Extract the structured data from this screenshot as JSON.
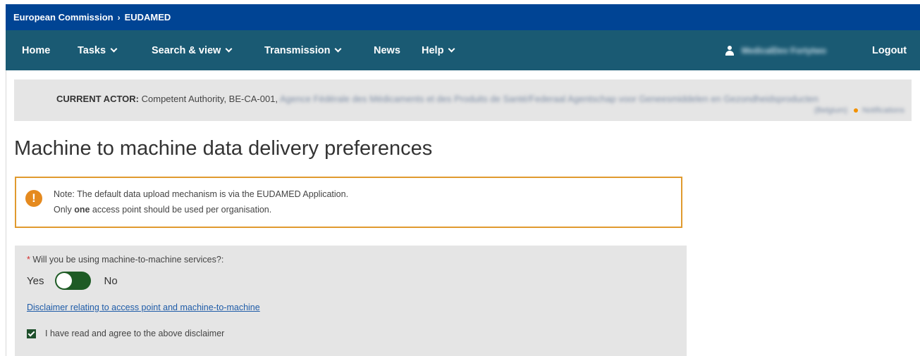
{
  "breadcrumb": {
    "item1": "European Commission",
    "separator": "›",
    "item2": "EUDAMED"
  },
  "nav": {
    "home": "Home",
    "tasks": "Tasks",
    "search": "Search & view",
    "transmission": "Transmission",
    "news": "News",
    "help": "Help",
    "user_name": "MedicalDev Fortytwo",
    "logout": "Logout"
  },
  "actor": {
    "label": "CURRENT ACTOR:",
    "value": "Competent Authority, BE-CA-001,",
    "org_blurred": "Agence Fédérale des Médicaments et des Produits de Santé/Federaal Agentschap voor Geneesmiddelen en Gezondheidsproducten",
    "country_blurred": "(Belgium)",
    "notifications": "Notifications"
  },
  "page_title": "Machine to machine data delivery preferences",
  "note": {
    "line1": "Note: The default data upload mechanism is via the EUDAMED Application.",
    "line2_pre": "Only ",
    "line2_bold": "one",
    "line2_post": " access point should be used per organisation."
  },
  "form": {
    "required_mark": "*",
    "question": " Will you be using machine-to-machine services?:",
    "yes_label": "Yes",
    "no_label": "No",
    "toggle_state": "No",
    "disclaimer_link": "Disclaimer relating to access point and machine-to-machine",
    "agree_label": "I have read and agree to the above disclaimer",
    "agree_checked": true
  },
  "colors": {
    "topbar": "#004494",
    "navbar": "#1a5a73",
    "warning": "#e58a1f",
    "toggle": "#1e5b25"
  }
}
